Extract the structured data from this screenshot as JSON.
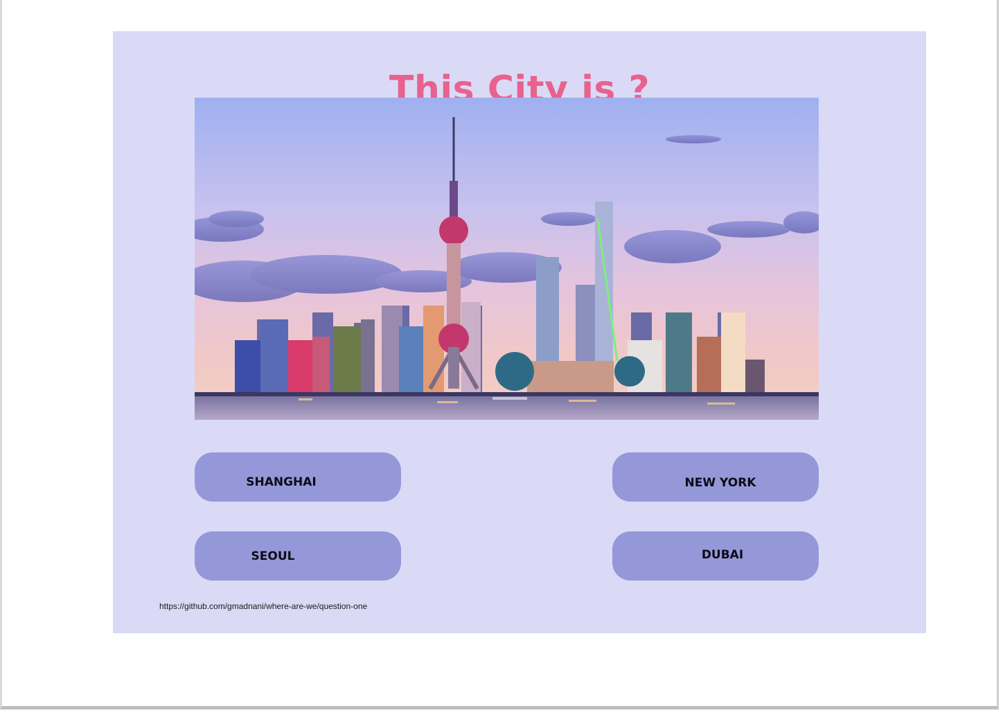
{
  "quiz": {
    "title": "This City is ?",
    "image_alt_subject": "city-skyline-photo",
    "answers": [
      {
        "label": "SHANGHAI"
      },
      {
        "label": "NEW YORK"
      },
      {
        "label": "SEOUL"
      },
      {
        "label": "DUBAI"
      }
    ],
    "source_url": "https://github.com/gmadnani/where-are-we/question-one"
  },
  "colors": {
    "card_background": "#dadaf7",
    "title": "#e8628d",
    "button": "#9598d8",
    "button_text": "#0b0b18"
  }
}
